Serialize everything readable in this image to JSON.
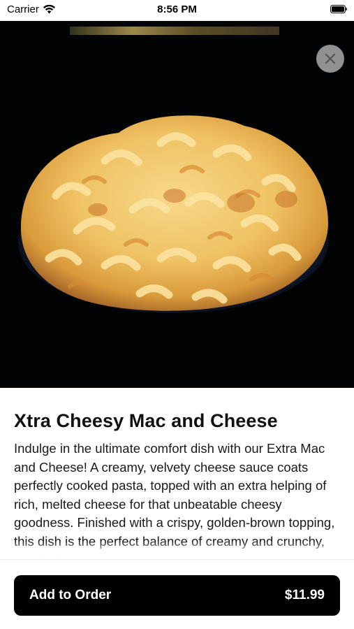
{
  "status_bar": {
    "carrier": "Carrier",
    "time": "8:56 PM",
    "wifi_icon": "wifi-icon",
    "battery_icon": "battery-icon"
  },
  "hero": {
    "image": "mac-and-cheese-photo",
    "close_icon": "close-icon"
  },
  "item": {
    "title": "Xtra Cheesy Mac and Cheese",
    "description": "Indulge in the ultimate comfort dish with our Extra Mac and Cheese! A creamy, velvety cheese sauce coats perfectly cooked pasta, topped with an extra helping of rich, melted cheese for that unbeatable cheesy goodness. Finished with a crispy, golden-brown topping, this dish is the perfect balance of creamy and crunchy, making it"
  },
  "order_button": {
    "label": "Add to Order",
    "price": "$11.99"
  },
  "colors": {
    "button_bg": "#000000",
    "hero_bg": "#020305",
    "close_bg": "#aaaaaa"
  }
}
